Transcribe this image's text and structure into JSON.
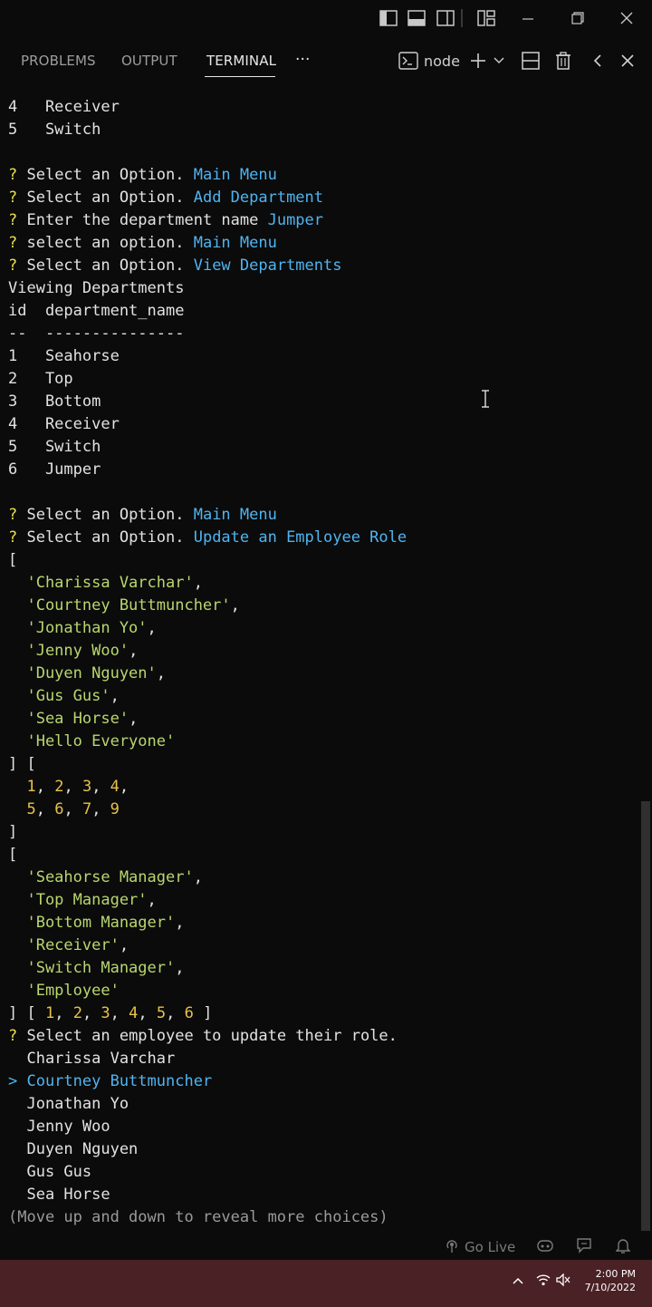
{
  "panel": {
    "tabs": [
      {
        "label": "PROBLEMS"
      },
      {
        "label": "OUTPUT"
      },
      {
        "label": "TERMINAL"
      }
    ],
    "more": "···",
    "terminal_name": "node"
  },
  "terminal": {
    "lines": [
      [
        {
          "t": "4   Receiver",
          "c": "w"
        }
      ],
      [
        {
          "t": "5   Switch",
          "c": "w"
        }
      ],
      [],
      [
        {
          "t": "? ",
          "c": "q"
        },
        {
          "t": "Select an Option. ",
          "c": "w"
        },
        {
          "t": "Main Menu",
          "c": "b"
        }
      ],
      [
        {
          "t": "? ",
          "c": "q"
        },
        {
          "t": "Select an Option. ",
          "c": "w"
        },
        {
          "t": "Add Department",
          "c": "b"
        }
      ],
      [
        {
          "t": "? ",
          "c": "q"
        },
        {
          "t": "Enter the department name ",
          "c": "w"
        },
        {
          "t": "Jumper",
          "c": "b"
        }
      ],
      [
        {
          "t": "? ",
          "c": "q"
        },
        {
          "t": "select an option. ",
          "c": "w"
        },
        {
          "t": "Main Menu",
          "c": "b"
        }
      ],
      [
        {
          "t": "? ",
          "c": "q"
        },
        {
          "t": "Select an Option. ",
          "c": "w"
        },
        {
          "t": "View Departments",
          "c": "b"
        }
      ],
      [
        {
          "t": "Viewing Departments",
          "c": "w"
        }
      ],
      [
        {
          "t": "id  department_name",
          "c": "w"
        }
      ],
      [
        {
          "t": "--  ---------------",
          "c": "w"
        }
      ],
      [
        {
          "t": "1   Seahorse",
          "c": "w"
        }
      ],
      [
        {
          "t": "2   Top",
          "c": "w"
        }
      ],
      [
        {
          "t": "3   Bottom",
          "c": "w"
        }
      ],
      [
        {
          "t": "4   Receiver",
          "c": "w"
        }
      ],
      [
        {
          "t": "5   Switch",
          "c": "w"
        }
      ],
      [
        {
          "t": "6   Jumper",
          "c": "w"
        }
      ],
      [],
      [
        {
          "t": "? ",
          "c": "q"
        },
        {
          "t": "Select an Option. ",
          "c": "w"
        },
        {
          "t": "Main Menu",
          "c": "b"
        }
      ],
      [
        {
          "t": "? ",
          "c": "q"
        },
        {
          "t": "Select an Option. ",
          "c": "w"
        },
        {
          "t": "Update an Employee Role",
          "c": "b"
        }
      ],
      [
        {
          "t": "[",
          "c": "w"
        }
      ],
      [
        {
          "t": "  'Charissa Varchar'",
          "c": "g"
        },
        {
          "t": ",",
          "c": "w"
        }
      ],
      [
        {
          "t": "  'Courtney Buttmuncher'",
          "c": "g"
        },
        {
          "t": ",",
          "c": "w"
        }
      ],
      [
        {
          "t": "  'Jonathan Yo'",
          "c": "g"
        },
        {
          "t": ",",
          "c": "w"
        }
      ],
      [
        {
          "t": "  'Jenny Woo'",
          "c": "g"
        },
        {
          "t": ",",
          "c": "w"
        }
      ],
      [
        {
          "t": "  'Duyen Nguyen'",
          "c": "g"
        },
        {
          "t": ",",
          "c": "w"
        }
      ],
      [
        {
          "t": "  'Gus Gus'",
          "c": "g"
        },
        {
          "t": ",",
          "c": "w"
        }
      ],
      [
        {
          "t": "  'Sea Horse'",
          "c": "g"
        },
        {
          "t": ",",
          "c": "w"
        }
      ],
      [
        {
          "t": "  'Hello Everyone'",
          "c": "g"
        }
      ],
      [
        {
          "t": "] [",
          "c": "w"
        }
      ],
      [
        {
          "t": "  1",
          "c": "y"
        },
        {
          "t": ", ",
          "c": "w"
        },
        {
          "t": "2",
          "c": "y"
        },
        {
          "t": ", ",
          "c": "w"
        },
        {
          "t": "3",
          "c": "y"
        },
        {
          "t": ", ",
          "c": "w"
        },
        {
          "t": "4",
          "c": "y"
        },
        {
          "t": ",",
          "c": "w"
        }
      ],
      [
        {
          "t": "  5",
          "c": "y"
        },
        {
          "t": ", ",
          "c": "w"
        },
        {
          "t": "6",
          "c": "y"
        },
        {
          "t": ", ",
          "c": "w"
        },
        {
          "t": "7",
          "c": "y"
        },
        {
          "t": ", ",
          "c": "w"
        },
        {
          "t": "9",
          "c": "y"
        }
      ],
      [
        {
          "t": "]",
          "c": "w"
        }
      ],
      [
        {
          "t": "[",
          "c": "w"
        }
      ],
      [
        {
          "t": "  'Seahorse Manager'",
          "c": "g"
        },
        {
          "t": ",",
          "c": "w"
        }
      ],
      [
        {
          "t": "  'Top Manager'",
          "c": "g"
        },
        {
          "t": ",",
          "c": "w"
        }
      ],
      [
        {
          "t": "  'Bottom Manager'",
          "c": "g"
        },
        {
          "t": ",",
          "c": "w"
        }
      ],
      [
        {
          "t": "  'Receiver'",
          "c": "g"
        },
        {
          "t": ",",
          "c": "w"
        }
      ],
      [
        {
          "t": "  'Switch Manager'",
          "c": "g"
        },
        {
          "t": ",",
          "c": "w"
        }
      ],
      [
        {
          "t": "  'Employee'",
          "c": "g"
        }
      ],
      [
        {
          "t": "] [ ",
          "c": "w"
        },
        {
          "t": "1",
          "c": "y"
        },
        {
          "t": ", ",
          "c": "w"
        },
        {
          "t": "2",
          "c": "y"
        },
        {
          "t": ", ",
          "c": "w"
        },
        {
          "t": "3",
          "c": "y"
        },
        {
          "t": ", ",
          "c": "w"
        },
        {
          "t": "4",
          "c": "y"
        },
        {
          "t": ", ",
          "c": "w"
        },
        {
          "t": "5",
          "c": "y"
        },
        {
          "t": ", ",
          "c": "w"
        },
        {
          "t": "6",
          "c": "y"
        },
        {
          "t": " ]",
          "c": "w"
        }
      ],
      [
        {
          "t": "? ",
          "c": "q"
        },
        {
          "t": "Select an employee to update their role.",
          "c": "w"
        }
      ],
      [
        {
          "t": "  Charissa Varchar",
          "c": "w"
        }
      ],
      [
        {
          "t": "> Courtney Buttmuncher",
          "c": "b"
        }
      ],
      [
        {
          "t": "  Jonathan Yo",
          "c": "w"
        }
      ],
      [
        {
          "t": "  Jenny Woo",
          "c": "w"
        }
      ],
      [
        {
          "t": "  Duyen Nguyen",
          "c": "w"
        }
      ],
      [
        {
          "t": "  Gus Gus",
          "c": "w"
        }
      ],
      [
        {
          "t": "  Sea Horse",
          "c": "w"
        }
      ],
      [
        {
          "t": "(Move up and down to reveal more choices)",
          "c": "gray"
        }
      ]
    ]
  },
  "statusbar": {
    "go_live": "Go Live"
  },
  "taskbar": {
    "time": "2:00 PM",
    "date": "7/10/2022"
  },
  "icons": {
    "layout_icons": [
      "toggle-primary-sidebar-icon",
      "toggle-panel-icon",
      "toggle-secondary-sidebar-icon",
      "customize-layout-icon"
    ],
    "window_controls": [
      "minimize-icon",
      "restore-icon",
      "close-icon"
    ]
  }
}
